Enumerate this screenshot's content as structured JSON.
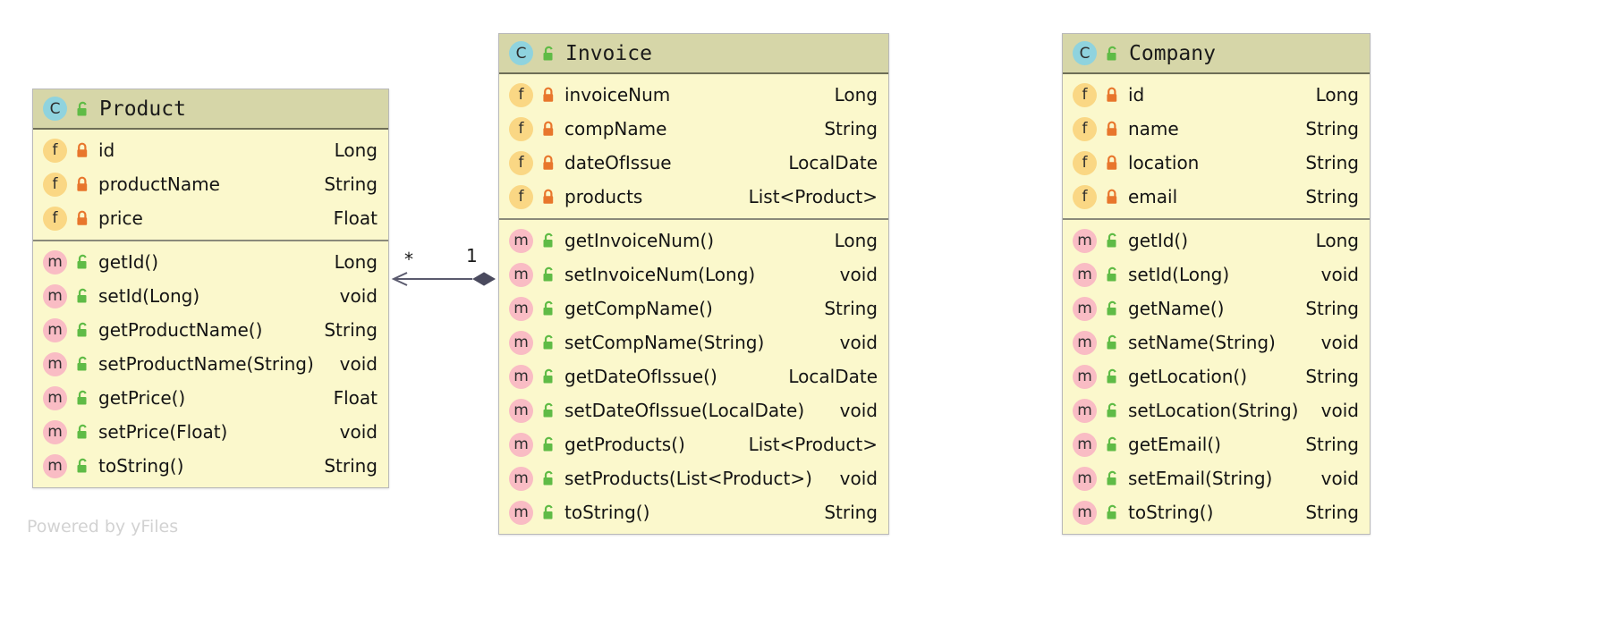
{
  "diagram": {
    "type": "uml-class-diagram",
    "watermark": "Powered by yFiles",
    "colors": {
      "header_bg": "#d6d6a8",
      "body_bg": "#fbf8cc",
      "class_icon": "#8fd3de",
      "field_icon": "#fad784",
      "method_icon": "#f9bcc4",
      "lock_private": "#e8762c",
      "lock_public": "#5fbb46",
      "connector": "#5a5a6e"
    }
  },
  "classes": [
    {
      "name": "Product",
      "icon": "class-icon",
      "visibility_icon": "unlock-icon",
      "fields": [
        {
          "name": "id",
          "type": "Long",
          "icon": "field-icon",
          "visibility_icon": "lock-icon"
        },
        {
          "name": "productName",
          "type": "String",
          "icon": "field-icon",
          "visibility_icon": "lock-icon"
        },
        {
          "name": "price",
          "type": "Float",
          "icon": "field-icon",
          "visibility_icon": "lock-icon"
        }
      ],
      "methods": [
        {
          "name": "getId()",
          "type": "Long",
          "icon": "method-icon",
          "visibility_icon": "unlock-icon"
        },
        {
          "name": "setId(Long)",
          "type": "void",
          "icon": "method-icon",
          "visibility_icon": "unlock-icon"
        },
        {
          "name": "getProductName()",
          "type": "String",
          "icon": "method-icon",
          "visibility_icon": "unlock-icon"
        },
        {
          "name": "setProductName(String)",
          "type": "void",
          "icon": "method-icon",
          "visibility_icon": "unlock-icon"
        },
        {
          "name": "getPrice()",
          "type": "Float",
          "icon": "method-icon",
          "visibility_icon": "unlock-icon"
        },
        {
          "name": "setPrice(Float)",
          "type": "void",
          "icon": "method-icon",
          "visibility_icon": "unlock-icon"
        },
        {
          "name": "toString()",
          "type": "String",
          "icon": "method-icon",
          "visibility_icon": "unlock-icon"
        }
      ]
    },
    {
      "name": "Invoice",
      "icon": "class-icon",
      "visibility_icon": "unlock-icon",
      "fields": [
        {
          "name": "invoiceNum",
          "type": "Long",
          "icon": "field-icon",
          "visibility_icon": "lock-icon"
        },
        {
          "name": "compName",
          "type": "String",
          "icon": "field-icon",
          "visibility_icon": "lock-icon"
        },
        {
          "name": "dateOfIssue",
          "type": "LocalDate",
          "icon": "field-icon",
          "visibility_icon": "lock-icon"
        },
        {
          "name": "products",
          "type": "List<Product>",
          "icon": "field-icon",
          "visibility_icon": "lock-icon"
        }
      ],
      "methods": [
        {
          "name": "getInvoiceNum()",
          "type": "Long",
          "icon": "method-icon",
          "visibility_icon": "unlock-icon"
        },
        {
          "name": "setInvoiceNum(Long)",
          "type": "void",
          "icon": "method-icon",
          "visibility_icon": "unlock-icon"
        },
        {
          "name": "getCompName()",
          "type": "String",
          "icon": "method-icon",
          "visibility_icon": "unlock-icon"
        },
        {
          "name": "setCompName(String)",
          "type": "void",
          "icon": "method-icon",
          "visibility_icon": "unlock-icon"
        },
        {
          "name": "getDateOfIssue()",
          "type": "LocalDate",
          "icon": "method-icon",
          "visibility_icon": "unlock-icon"
        },
        {
          "name": "setDateOfIssue(LocalDate)",
          "type": "void",
          "icon": "method-icon",
          "visibility_icon": "unlock-icon"
        },
        {
          "name": "getProducts()",
          "type": "List<Product>",
          "icon": "method-icon",
          "visibility_icon": "unlock-icon"
        },
        {
          "name": "setProducts(List<Product>)",
          "type": "void",
          "icon": "method-icon",
          "visibility_icon": "unlock-icon"
        },
        {
          "name": "toString()",
          "type": "String",
          "icon": "method-icon",
          "visibility_icon": "unlock-icon"
        }
      ]
    },
    {
      "name": "Company",
      "icon": "class-icon",
      "visibility_icon": "unlock-icon",
      "fields": [
        {
          "name": "id",
          "type": "Long",
          "icon": "field-icon",
          "visibility_icon": "lock-icon"
        },
        {
          "name": "name",
          "type": "String",
          "icon": "field-icon",
          "visibility_icon": "lock-icon"
        },
        {
          "name": "location",
          "type": "String",
          "icon": "field-icon",
          "visibility_icon": "lock-icon"
        },
        {
          "name": "email",
          "type": "String",
          "icon": "field-icon",
          "visibility_icon": "lock-icon"
        }
      ],
      "methods": [
        {
          "name": "getId()",
          "type": "Long",
          "icon": "method-icon",
          "visibility_icon": "unlock-icon"
        },
        {
          "name": "setId(Long)",
          "type": "void",
          "icon": "method-icon",
          "visibility_icon": "unlock-icon"
        },
        {
          "name": "getName()",
          "type": "String",
          "icon": "method-icon",
          "visibility_icon": "unlock-icon"
        },
        {
          "name": "setName(String)",
          "type": "void",
          "icon": "method-icon",
          "visibility_icon": "unlock-icon"
        },
        {
          "name": "getLocation()",
          "type": "String",
          "icon": "method-icon",
          "visibility_icon": "unlock-icon"
        },
        {
          "name": "setLocation(String)",
          "type": "void",
          "icon": "method-icon",
          "visibility_icon": "unlock-icon"
        },
        {
          "name": "getEmail()",
          "type": "String",
          "icon": "method-icon",
          "visibility_icon": "unlock-icon"
        },
        {
          "name": "setEmail(String)",
          "type": "void",
          "icon": "method-icon",
          "visibility_icon": "unlock-icon"
        },
        {
          "name": "toString()",
          "type": "String",
          "icon": "method-icon",
          "visibility_icon": "unlock-icon"
        }
      ]
    }
  ],
  "connections": [
    {
      "kind": "composition",
      "source": "Product",
      "target": "Invoice",
      "source_multiplicity": "*",
      "target_multiplicity": "1"
    }
  ],
  "icon_glyphs": {
    "class-icon": "C",
    "field-icon": "f",
    "method-icon": "m"
  }
}
